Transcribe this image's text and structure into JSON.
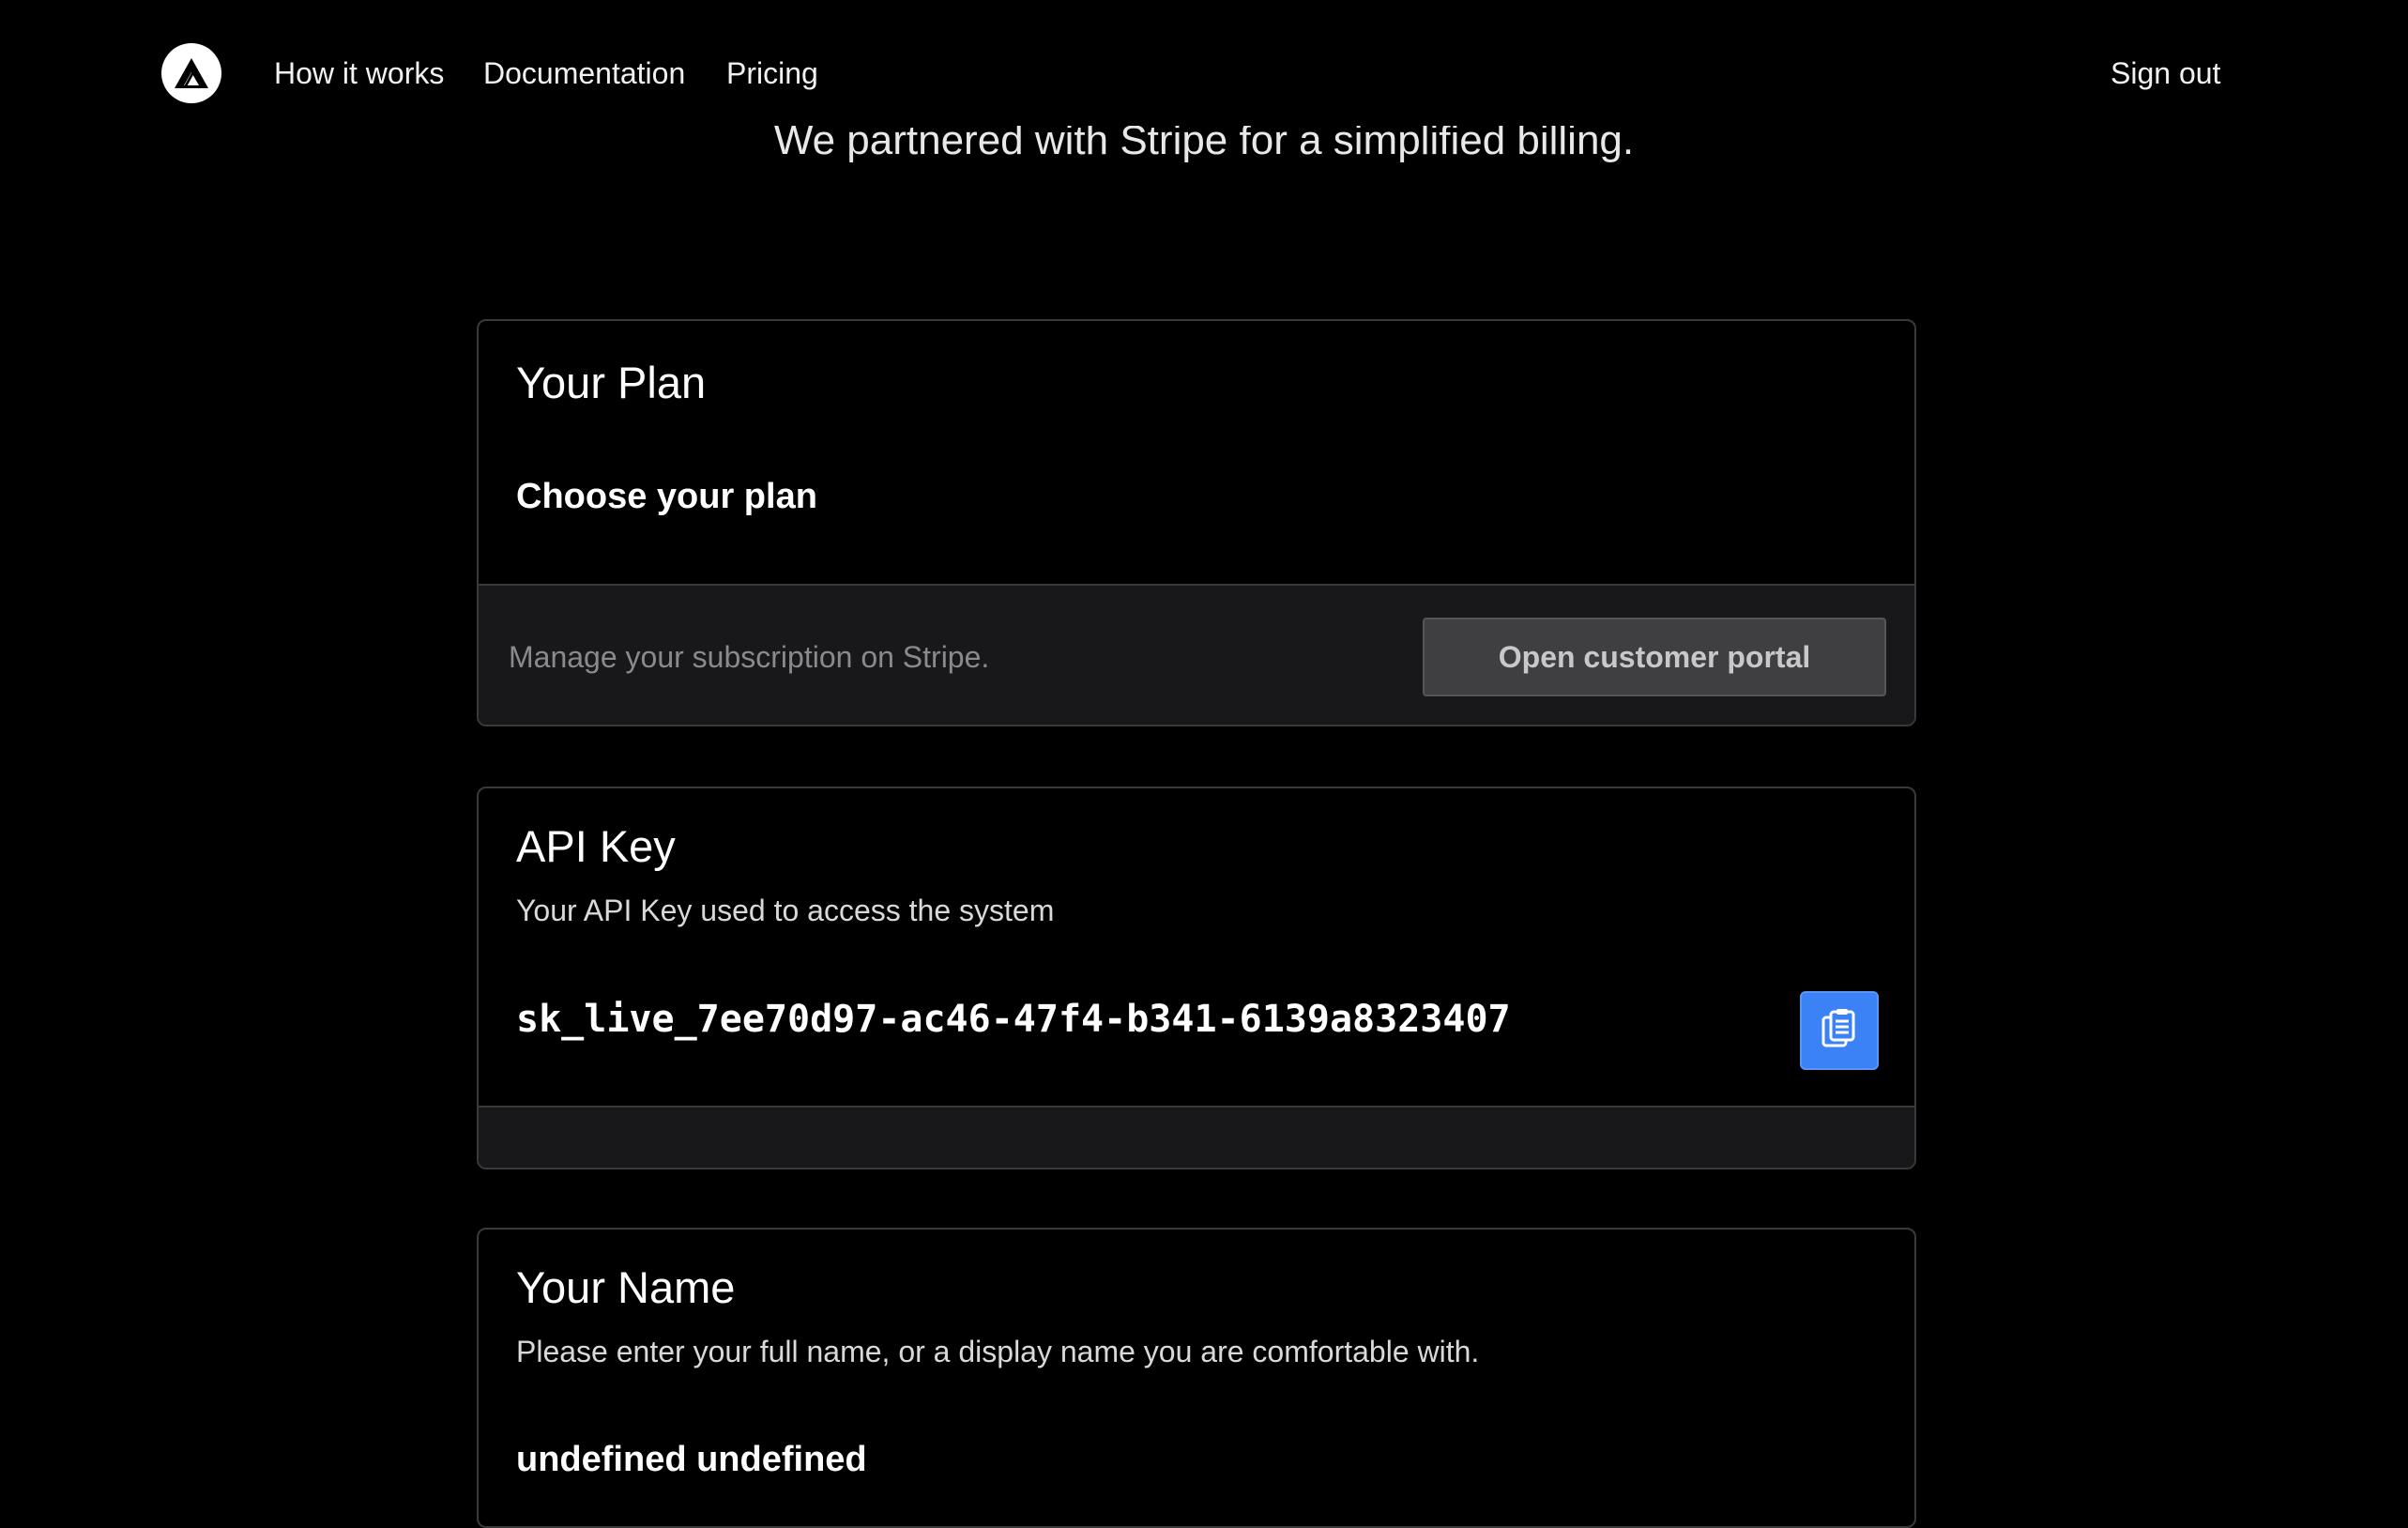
{
  "nav": {
    "logo_icon": "triangle-logo-icon",
    "links": [
      "How it works",
      "Documentation",
      "Pricing"
    ],
    "sign_out": "Sign out"
  },
  "page": {
    "subtitle": "We partnered with Stripe for a simplified billing."
  },
  "plan": {
    "title": "Your Plan",
    "choose_label": "Choose your plan",
    "footer_text": "Manage your subscription on Stripe.",
    "portal_button": "Open customer portal"
  },
  "api_key": {
    "title": "API Key",
    "description": "Your API Key used to access the system",
    "value": "sk_live_7ee70d97-ac46-47f4-b341-6139a8323407",
    "copy_icon": "clipboard-icon"
  },
  "name": {
    "title": "Your Name",
    "description": "Please enter your full name, or a display name you are comfortable with.",
    "value": "undefined undefined"
  },
  "colors": {
    "background": "#000000",
    "card_border": "#3a3a3d",
    "footer_bg": "#18181b",
    "accent_blue": "#3b82f6",
    "button_grey": "#3f3f42"
  }
}
